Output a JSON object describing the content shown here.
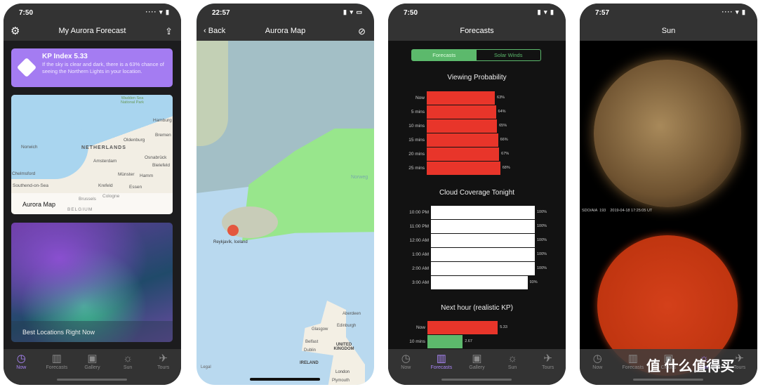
{
  "tabs": [
    {
      "label": "Now",
      "icon": "clock-icon"
    },
    {
      "label": "Forecasts",
      "icon": "bar-chart-icon"
    },
    {
      "label": "Gallery",
      "icon": "gallery-icon"
    },
    {
      "label": "Sun",
      "icon": "sun-icon"
    },
    {
      "label": "Tours",
      "icon": "airplane-icon"
    }
  ],
  "tabs_sun": [
    {
      "label": "Now"
    },
    {
      "label": "Forecasts"
    },
    {
      "label": "Clouds"
    },
    {
      "label": "Sun"
    },
    {
      "label": "Tours"
    }
  ],
  "phone1": {
    "time": "7:50",
    "title": "My Aurora Forecast",
    "kp_title": "KP Index 5.33",
    "kp_text": "If the sky is clear and dark, there is a 63% chance of seeing the Northern Lights in your location.",
    "map_card": "Aurora Map",
    "aurora_card": "Best Locations Right Now",
    "map_labels": [
      "Wadden Sea National Park",
      "Hamburg",
      "Bremen",
      "Oldenburg",
      "Norwich",
      "NETHERLANDS",
      "Amsterdam",
      "Osnabrück",
      "Bielefeld",
      "Münster",
      "Hamm",
      "Chelmsford",
      "Southend-on-Sea",
      "Krefeld",
      "Essen",
      "Brussels",
      "Cologne",
      "BELGIUM"
    ]
  },
  "phone2": {
    "time": "22:57",
    "title": "Aurora Map",
    "back": "Back",
    "pin_label": "Reykjavík, Iceland",
    "legal": "Legal",
    "map_labels": [
      "Norweg",
      "Aberdeen",
      "Glasgow",
      "Edinburgh",
      "Belfast",
      "UNITED KINGDOM",
      "Dublin",
      "IRELAND",
      "London",
      "Plymouth"
    ]
  },
  "phone3": {
    "time": "7:50",
    "title": "Forecasts",
    "segments": [
      "Forecasts",
      "Solar Winds"
    ]
  },
  "phone4": {
    "time": "7:57",
    "title": "Sun",
    "caption": "SDO/AIA  193    2019-04-18 17:25:05 UT",
    "watermark": "值 什么值得买"
  },
  "colors": {
    "accent": "#a985f6",
    "kp_card": "#a47cf2",
    "bar_red": "#e8352a",
    "bar_green": "#5cb96c",
    "aurora_zone": "#98e68c"
  },
  "chart_data": [
    {
      "type": "bar",
      "title": "Viewing Probability",
      "categories": [
        "Now",
        "5 mins",
        "10 mins",
        "15 mins",
        "20 mins",
        "25 mins"
      ],
      "values": [
        63,
        64,
        65,
        66,
        67,
        68
      ],
      "value_labels": [
        "63%",
        "64%",
        "65%",
        "66%",
        "67%",
        "68%"
      ],
      "unit": "%"
    },
    {
      "type": "bar",
      "title": "Cloud Coverage Tonight",
      "categories": [
        "10:00 PM",
        "11:00 PM",
        "12:00 AM",
        "1:00 AM",
        "2:00 AM",
        "3:00 AM"
      ],
      "values": [
        100,
        100,
        100,
        100,
        100,
        93
      ],
      "value_labels": [
        "100%",
        "100%",
        "100%",
        "100%",
        "100%",
        "93%"
      ],
      "unit": "%"
    },
    {
      "type": "bar",
      "title": "Next hour (realistic KP)",
      "categories": [
        "Now",
        "10 mins"
      ],
      "values": [
        5.33,
        2.67
      ],
      "value_labels": [
        "5.33",
        "2.67"
      ],
      "colors": [
        "#e8352a",
        "#5cb96c"
      ]
    }
  ]
}
